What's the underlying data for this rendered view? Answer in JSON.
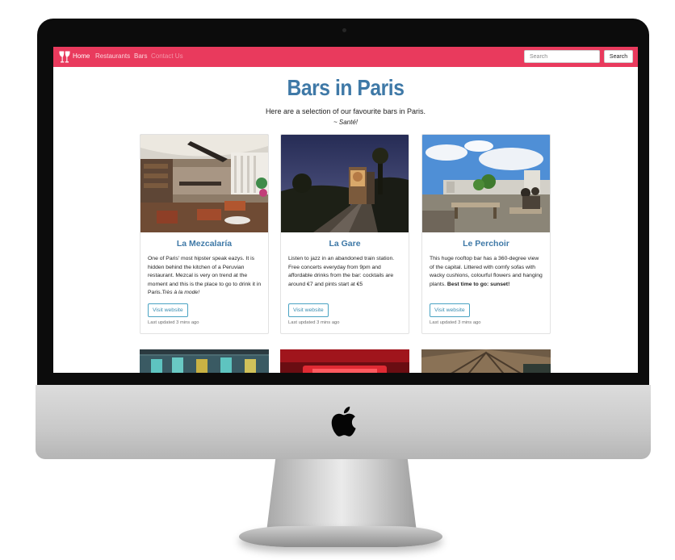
{
  "navbar": {
    "brand_icon": "cocktail-glasses-icon",
    "links": [
      {
        "label": "Home",
        "state": "active"
      },
      {
        "label": "Restaurants",
        "state": "default"
      },
      {
        "label": "Bars",
        "state": "default"
      },
      {
        "label": "Contact Us",
        "state": "muted"
      }
    ],
    "search": {
      "placeholder": "Search",
      "value": "",
      "button_label": "Search"
    },
    "color": "#e93a5d"
  },
  "page": {
    "title": "Bars in Paris",
    "intro": "Here are a selection of our favourite bars in Paris.",
    "intro_sub": "~ Santé!",
    "accent_color": "#3f79a7"
  },
  "cards": [
    {
      "title": "La Mezcalaría",
      "text": "One of Paris' most hipster speak eazys. It is hidden behind the kitchen of a Peruvian restaurant. Mezcal is very on trend at the moment and this is the place to go to drink it in Paris.",
      "text_emphasis": "Très à la mode!",
      "button": "Visit website",
      "updated": "Last updated 3 mins ago",
      "image_icon": "bar-interior-photo"
    },
    {
      "title": "La Gare",
      "text": "Listen to jazz in an abandoned train station. Free concerts everyday from 9pm and affordable drinks from the bar: cocktails are around €7 and pints start at €5",
      "button": "Visit website",
      "updated": "Last updated 3 mins ago",
      "image_icon": "train-station-night-photo"
    },
    {
      "title": "Le Perchoir",
      "text": "This huge rooftop bar has a 360-degree view of the capital. Littered with comfy sofas with wacky cushions, colourful flowers and hanging plants.",
      "text_bold": "Best time to go: sunset!",
      "button": "Visit website",
      "updated": "Last updated 3 mins ago",
      "image_icon": "rooftop-terrace-photo"
    }
  ],
  "device": {
    "frame": "imac",
    "logo": "apple-logo-icon"
  }
}
